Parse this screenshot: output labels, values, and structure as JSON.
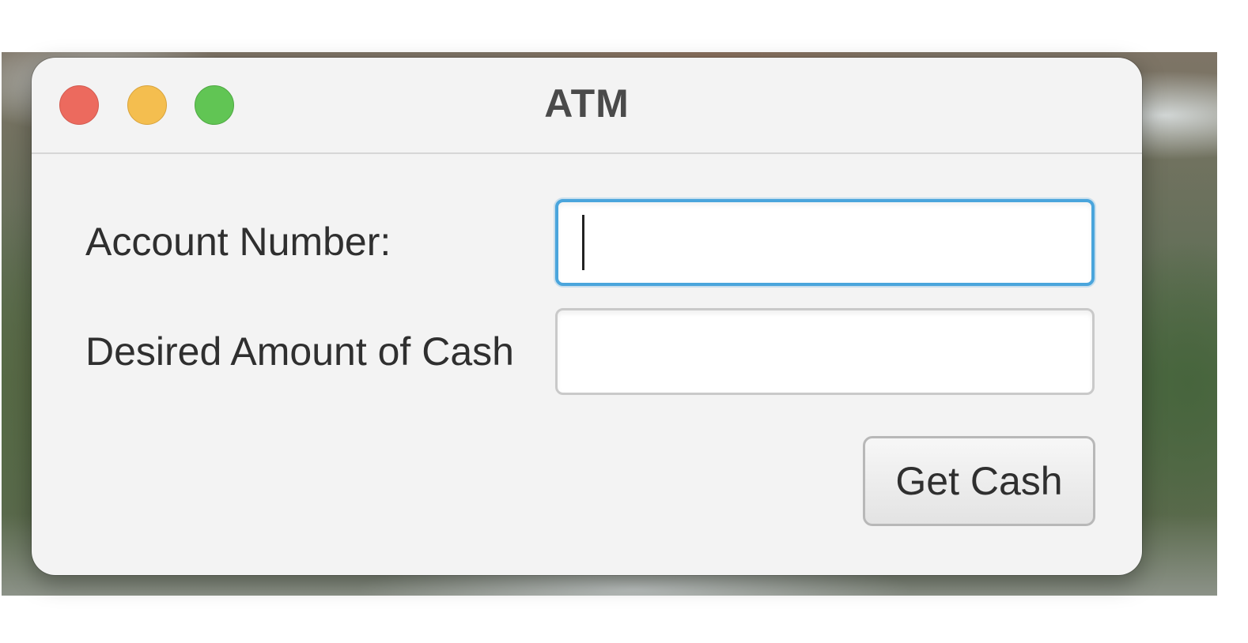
{
  "window": {
    "title": "ATM"
  },
  "titlebar": {
    "buttons": [
      "close",
      "minimize",
      "zoom"
    ],
    "colors": {
      "close": "#ec6a5e",
      "minimize": "#f4be4f",
      "zoom": "#61c554"
    }
  },
  "form": {
    "account_label": "Account Number:",
    "account_value": "",
    "cash_label": "Desired Amount of Cash",
    "cash_value": "",
    "submit_label": "Get Cash"
  },
  "focus_color": "#4aa5dc"
}
